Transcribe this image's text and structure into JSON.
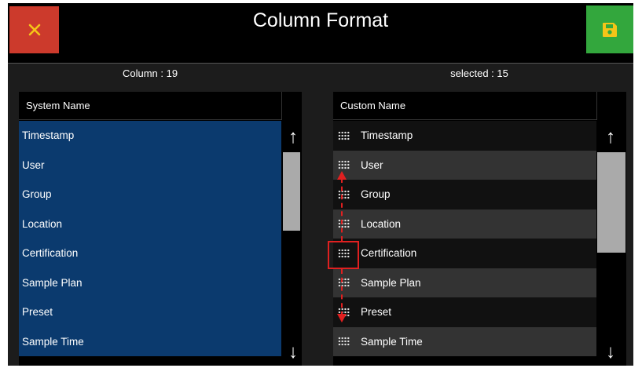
{
  "header": {
    "title": "Column Format",
    "close_icon": "close-icon",
    "save_icon": "save-icon",
    "close_color": "#cc3a2c",
    "save_color": "#33a73d"
  },
  "counts": {
    "column": "Column : 19",
    "selected": "selected : 15"
  },
  "system_panel": {
    "header": "System Name",
    "items": [
      "Timestamp",
      "User",
      "Group",
      "Location",
      "Certification",
      "Sample Plan",
      "Preset",
      "Sample Time"
    ],
    "selection_color": "#0b3a6e"
  },
  "custom_panel": {
    "header": "Custom Name",
    "items": [
      "Timestamp",
      "User",
      "Group",
      "Location",
      "Certification",
      "Sample Plan",
      "Preset",
      "Sample Time"
    ],
    "drag_handle_icon": "drag-handle-icon",
    "highlight_color": "#e02020"
  },
  "scroll": {
    "up_icon": "arrow-up-icon",
    "down_icon": "arrow-down-icon",
    "up_glyph": "↑",
    "down_glyph": "↓"
  }
}
